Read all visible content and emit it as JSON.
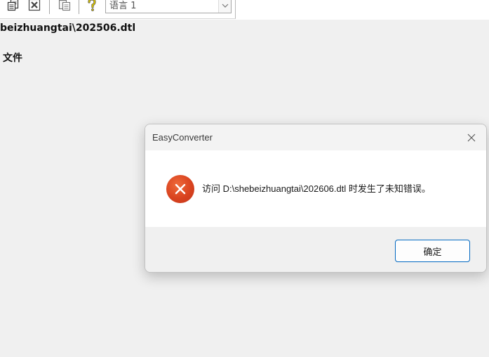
{
  "toolbar": {
    "icons": [
      "copy-icon",
      "close-file-icon",
      "paste-icon",
      "help-icon"
    ],
    "language_select": {
      "value": "语言 1",
      "arrow_icon": "chevron-down-icon"
    }
  },
  "main": {
    "path_text": "beizhuangtai\\202506.dtl",
    "file_label": "文件"
  },
  "dialog": {
    "title": "EasyConverter",
    "close_icon": "close-icon",
    "status_icon": "error-icon",
    "message": "访问 D:\\shebeizhuangtai\\202606.dtl 时发生了未知错误。",
    "ok_label": "确定"
  },
  "colors": {
    "page_background": "#f0f0f0",
    "dialog_content": "#ffffff",
    "error_icon": "#d9431f",
    "button_border": "#0067c0",
    "help_icon": "#c9b000"
  }
}
